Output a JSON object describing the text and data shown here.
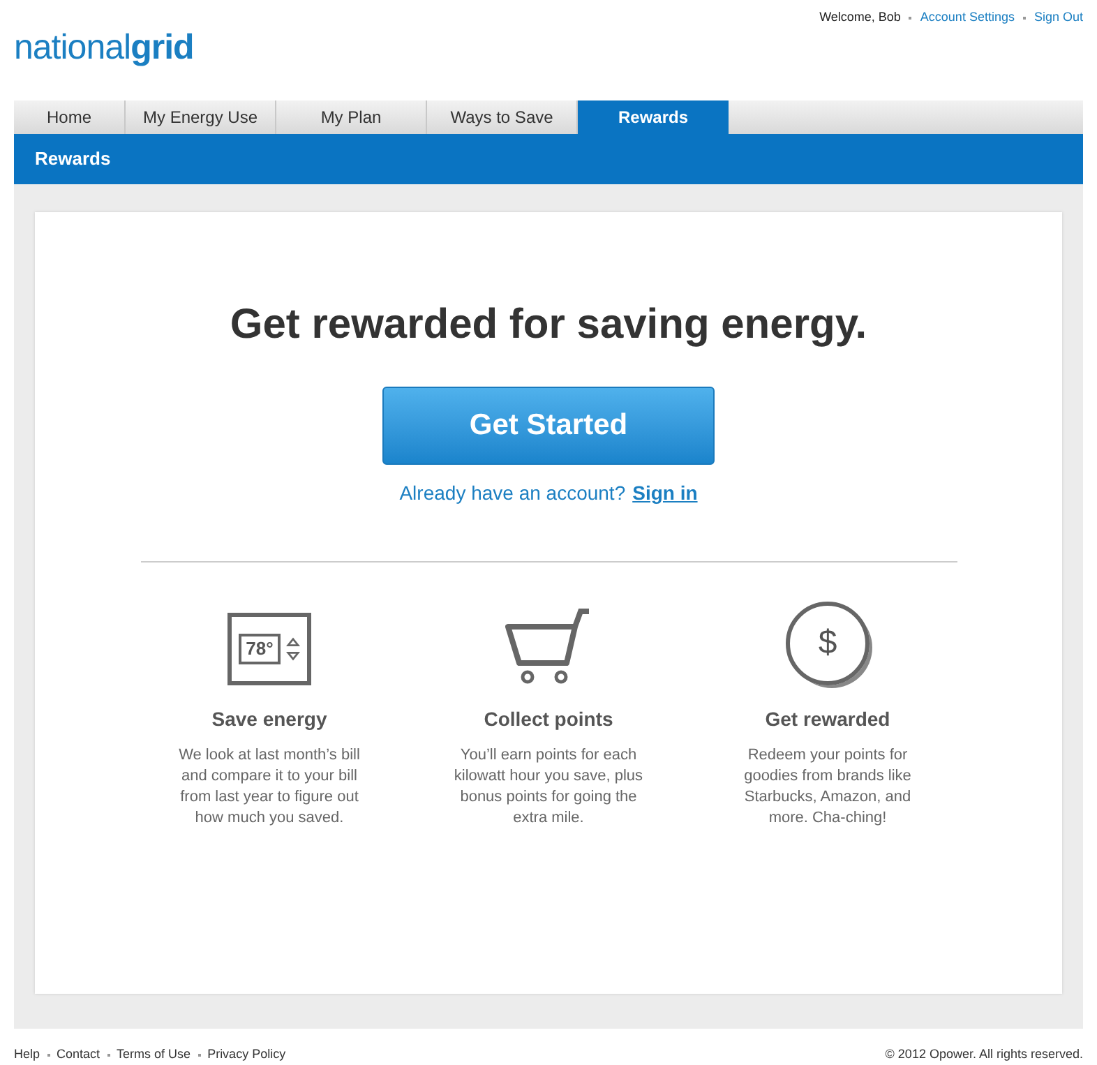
{
  "logo": "national**grid**",
  "user_links": [
    {
      "text": "Welcome, Bob",
      "kind": "text"
    },
    {
      "text": "Account Settings",
      "kind": "link"
    },
    {
      "text": "Sign Out",
      "kind": "link"
    }
  ],
  "tabs": [
    {
      "label": "Home",
      "selected": false
    },
    {
      "label": "My Energy Use",
      "selected": false
    },
    {
      "label": "My Plan",
      "selected": false
    },
    {
      "label": "Ways to Save",
      "selected": false
    },
    {
      "label": "Rewards",
      "selected": true
    }
  ],
  "section_title": "Rewards",
  "headline": "Get rewarded for saving energy.",
  "cta_button": "Get Started",
  "signin_prompt": "Already have an account?",
  "signin_link": "Sign in",
  "features": [
    {
      "kind": "thermostat",
      "icon_text": "78°",
      "title": "Save energy",
      "text": "We look at last month’s bill and compare it to your bill from last year to figure out how much you saved."
    },
    {
      "kind": "cart",
      "title": "Collect points",
      "text": "You’ll earn points for each kilowatt hour you save, plus bonus points for going the extra mile."
    },
    {
      "kind": "coin",
      "icon_text": "$",
      "title": "Get rewarded",
      "text": "Redeem your points for goodies from brands like Starbucks, Amazon, and more. Cha-ching!"
    }
  ],
  "footer_links": [
    "Help",
    "Contact",
    "Terms of Use",
    "Privacy Policy"
  ],
  "copyright": "© 2012 Opower. All rights reserved."
}
